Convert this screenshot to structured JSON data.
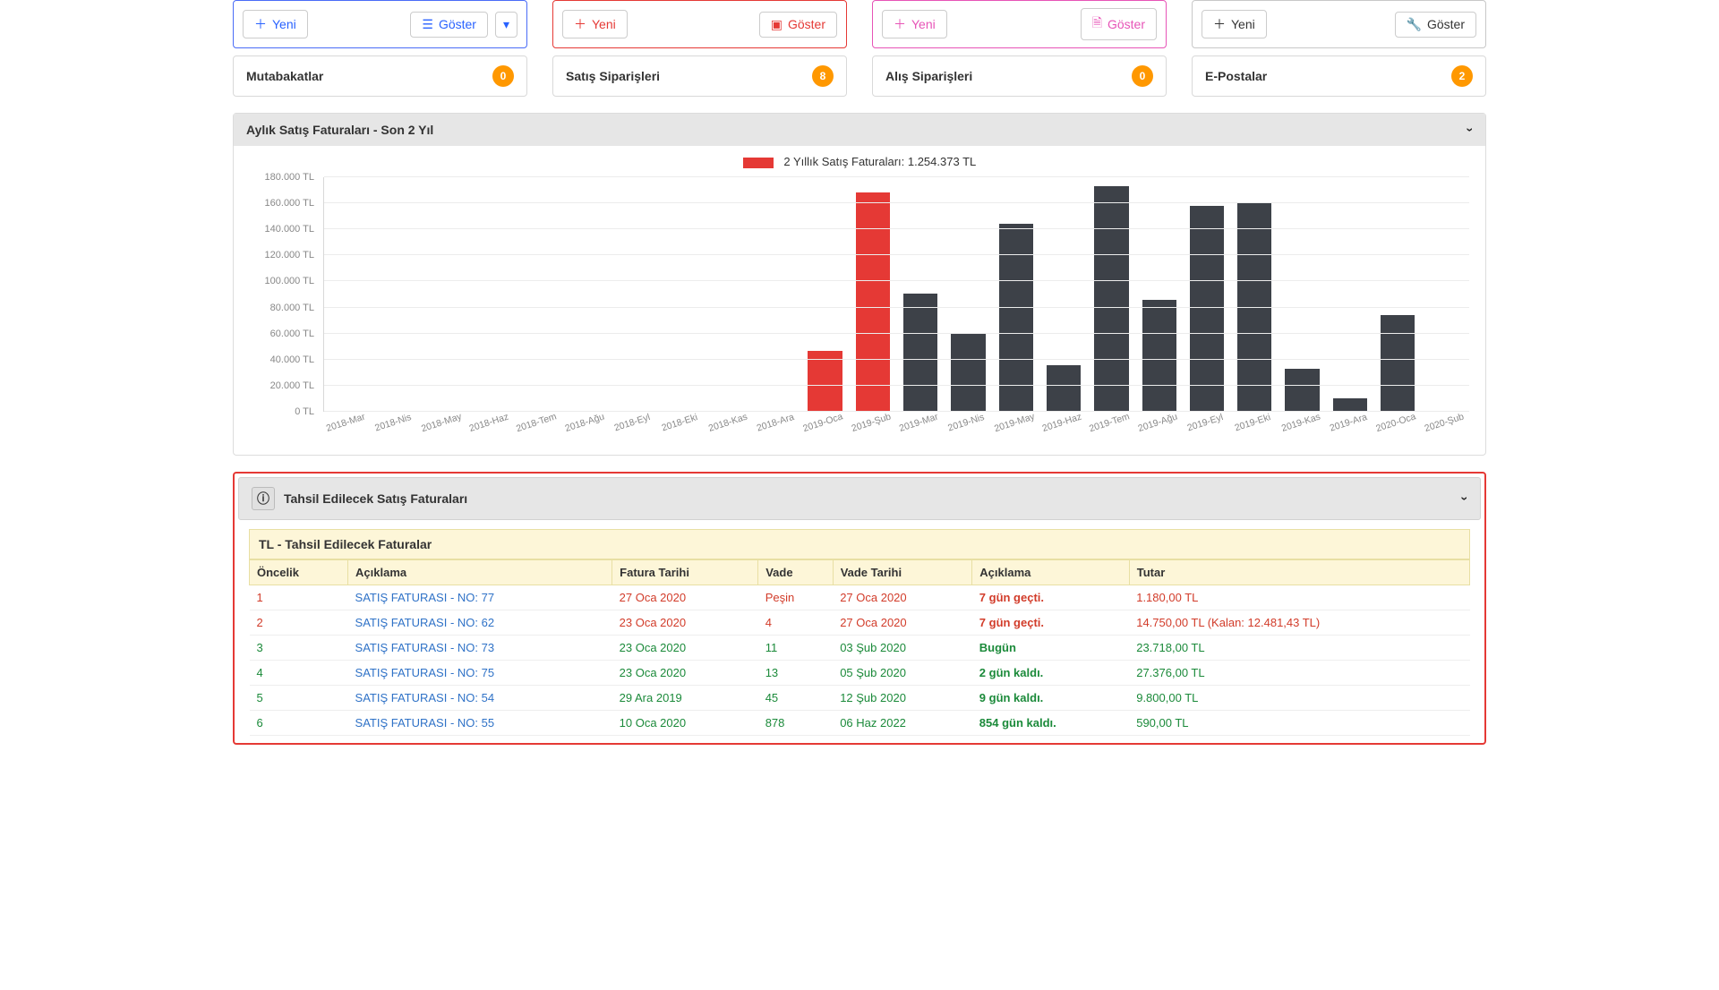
{
  "action_row": {
    "new_label": "Yeni",
    "show_label": "Göster"
  },
  "summary_cards": [
    {
      "title": "Mutabakatlar",
      "count": "0"
    },
    {
      "title": "Satış Siparişleri",
      "count": "8"
    },
    {
      "title": "Alış Siparişleri",
      "count": "0"
    },
    {
      "title": "E-Postalar",
      "count": "2"
    }
  ],
  "chart_panel_title": "Aylık Satış Faturaları - Son 2 Yıl",
  "chart_legend": "2 Yıllık Satış Faturaları: 1.254.373 TL",
  "chart_data": {
    "type": "bar",
    "ylabel": "",
    "title": "Aylık Satış Faturaları - Son 2 Yıl",
    "ylim": [
      0,
      180000
    ],
    "y_ticks": [
      "0 TL",
      "20.000 TL",
      "40.000 TL",
      "60.000 TL",
      "80.000 TL",
      "100.000 TL",
      "120.000 TL",
      "140.000 TL",
      "160.000 TL",
      "180.000 TL"
    ],
    "categories": [
      "2018-Mar",
      "2018-Nis",
      "2018-May",
      "2018-Haz",
      "2018-Tem",
      "2018-Ağu",
      "2018-Eyl",
      "2018-Eki",
      "2018-Kas",
      "2018-Ara",
      "2019-Oca",
      "2019-Şub",
      "2019-Mar",
      "2019-Nis",
      "2019-May",
      "2019-Haz",
      "2019-Tem",
      "2019-Ağu",
      "2019-Eyl",
      "2019-Eki",
      "2019-Kas",
      "2019-Ara",
      "2020-Oca",
      "2020-Şub"
    ],
    "series": [
      {
        "name": "2 Yıllık Satış Faturaları",
        "color": "auto",
        "values": [
          0,
          0,
          0,
          0,
          0,
          0,
          0,
          0,
          0,
          0,
          47000,
          168000,
          91000,
          60000,
          144000,
          36000,
          173000,
          86000,
          158000,
          161000,
          33000,
          10000,
          74000,
          0
        ]
      }
    ],
    "highlight_color": "#e53935",
    "highlight_indices": [
      10,
      11
    ],
    "default_color": "#3d4148"
  },
  "receivables_panel_title": "Tahsil Edilecek Satış Faturaları",
  "receivables_table_title": "TL - Tahsil Edilecek Faturalar",
  "receivables_headers": [
    "Öncelik",
    "Açıklama",
    "Fatura Tarihi",
    "Vade",
    "Vade Tarihi",
    "Açıklama",
    "Tutar"
  ],
  "receivables_rows": [
    {
      "prio": "1",
      "desc": "SATIŞ FATURASI - NO: 77",
      "date": "27 Oca 2020",
      "due": "Peşin",
      "due_date": "27 Oca 2020",
      "status": "7 gün geçti.",
      "amount": "1.180,00 TL",
      "status_cls": "t-red",
      "row_cls": "t-red",
      "due_cls": "t-red",
      "amount_cls": "t-red"
    },
    {
      "prio": "2",
      "desc": "SATIŞ FATURASI - NO: 62",
      "date": "23 Oca 2020",
      "due": "4",
      "due_date": "27 Oca 2020",
      "status": "7 gün geçti.",
      "amount": "14.750,00 TL (Kalan: 12.481,43 TL)",
      "status_cls": "t-red",
      "row_cls": "t-red",
      "due_cls": "t-red",
      "amount_cls": "t-red"
    },
    {
      "prio": "3",
      "desc": "SATIŞ FATURASI - NO: 73",
      "date": "23 Oca 2020",
      "due": "11",
      "due_date": "03 Şub 2020",
      "status": "Bugün",
      "amount": "23.718,00 TL",
      "status_cls": "t-green",
      "row_cls": "t-green",
      "due_cls": "t-green",
      "amount_cls": "t-green"
    },
    {
      "prio": "4",
      "desc": "SATIŞ FATURASI - NO: 75",
      "date": "23 Oca 2020",
      "due": "13",
      "due_date": "05 Şub 2020",
      "status": "2 gün kaldı.",
      "amount": "27.376,00 TL",
      "status_cls": "t-green",
      "row_cls": "t-green",
      "due_cls": "t-green",
      "amount_cls": "t-green"
    },
    {
      "prio": "5",
      "desc": "SATIŞ FATURASI - NO: 54",
      "date": "29 Ara 2019",
      "due": "45",
      "due_date": "12 Şub 2020",
      "status": "9 gün kaldı.",
      "amount": "9.800,00 TL",
      "status_cls": "t-green",
      "row_cls": "t-green",
      "due_cls": "t-green",
      "amount_cls": "t-green"
    },
    {
      "prio": "6",
      "desc": "SATIŞ FATURASI - NO: 55",
      "date": "10 Oca 2020",
      "due": "878",
      "due_date": "06 Haz 2022",
      "status": "854 gün kaldı.",
      "amount": "590,00 TL",
      "status_cls": "t-green",
      "row_cls": "t-green",
      "due_cls": "t-green",
      "amount_cls": "t-green"
    }
  ]
}
